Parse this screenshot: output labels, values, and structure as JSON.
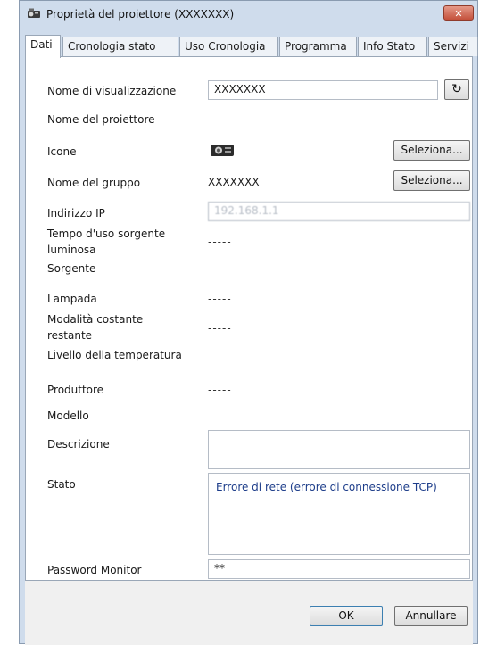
{
  "window": {
    "title": "Proprietà del proiettore (XXXXXXX)",
    "close_glyph": "✕"
  },
  "tabs": [
    {
      "label": "Dati"
    },
    {
      "label": "Cronologia stato"
    },
    {
      "label": "Uso Cronologia"
    },
    {
      "label": "Programma"
    },
    {
      "label": "Info Stato"
    },
    {
      "label": "Servizi"
    }
  ],
  "fields": {
    "display_name": {
      "label": "Nome di visualizzazione",
      "value": "XXXXXXX"
    },
    "projector_name": {
      "label": "Nome del proiettore",
      "value": "-----"
    },
    "icon": {
      "label": "Icone",
      "icon_name": "projector-icon"
    },
    "group_name": {
      "label": "Nome del gruppo",
      "value": "XXXXXXX"
    },
    "ip": {
      "label": "Indirizzo IP",
      "value": "192.168.1.1"
    },
    "light_source_time": {
      "label": "Tempo d'uso sorgente luminosa",
      "value": "-----"
    },
    "source": {
      "label": "Sorgente",
      "value": "-----"
    },
    "lamp": {
      "label": "Lampada",
      "value": "-----"
    },
    "constant_mode": {
      "label": "Modalità costante restante",
      "value": "-----"
    },
    "temperature": {
      "label": "Livello della temperatura",
      "value": "-----"
    },
    "manufacturer": {
      "label": "Produttore",
      "value": "-----"
    },
    "model": {
      "label": "Modello",
      "value": "-----"
    },
    "description": {
      "label": "Descrizione",
      "value": ""
    },
    "status": {
      "label": "Stato",
      "value": "Errore di rete (errore di connessione TCP)"
    },
    "monitor_password": {
      "label": "Password Monitor",
      "value": "**"
    }
  },
  "buttons": {
    "select": "Seleziona...",
    "ok": "OK",
    "cancel": "Annullare",
    "refresh_glyph": "↻"
  },
  "colors": {
    "window_bg": "#cfdcec",
    "status_text": "#1d3d8a"
  }
}
